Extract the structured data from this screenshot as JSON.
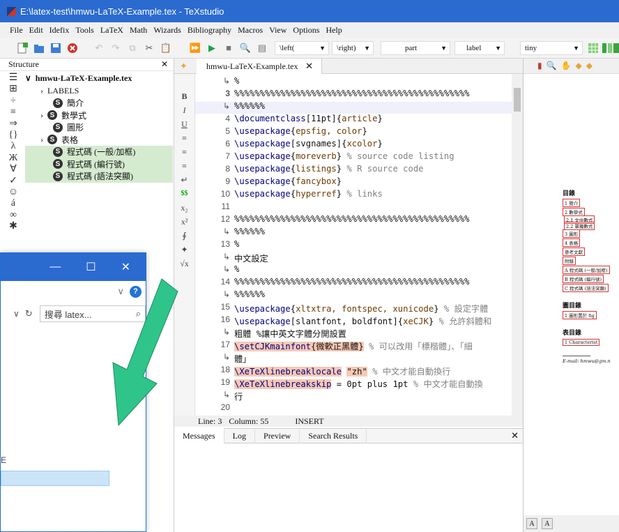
{
  "window": {
    "title": "E:\\latex-test\\hmwu-LaTeX-Example.tex - TeXstudio"
  },
  "menu": [
    "File",
    "Edit",
    "Idefix",
    "Tools",
    "LaTeX",
    "Math",
    "Wizards",
    "Bibliography",
    "Macros",
    "View",
    "Options",
    "Help"
  ],
  "toolbar": {
    "left_combo": "\\left(",
    "right_combo": "\\right)",
    "section_combo": "part",
    "ref_combo": "label",
    "size_combo": "tiny"
  },
  "structure": {
    "header": "Structure",
    "close": "✕",
    "sidebar_symbols": [
      "☰",
      "⊞",
      "÷",
      "≡",
      "⇒",
      "{}",
      "λ",
      "Ж",
      "∀",
      "✓",
      "☺",
      "á",
      "∞",
      "✱"
    ],
    "file": "hmwu-LaTeX-Example.tex",
    "labels": "LABELS",
    "sections": [
      "簡介",
      "數學式",
      "圖形",
      "表格",
      "程式碼 (一般/加框)",
      "程式碼 (編行號)",
      "程式碼 (語法突顯)"
    ],
    "section_icon_letter": "S"
  },
  "explorer": {
    "minimize": "—",
    "maximize": "☐",
    "close": "✕",
    "chevron": "∨",
    "help": "?",
    "refresh": "↻",
    "search_placeholder": "搜尋 latex...",
    "search_glyph": "⌕",
    "fragment": "E"
  },
  "editor": {
    "tab_name": "hmwu-LaTeX-Example.tex",
    "tab_close": "✕",
    "format_tools": [
      "B",
      "I",
      "U",
      "≡",
      "≡",
      "≡",
      "↵",
      "$$",
      "x₂",
      "x²",
      "∮",
      "✦",
      "√x"
    ],
    "status": {
      "line": "Line: 3",
      "column": "Column: 55",
      "mode": "INSERT"
    }
  },
  "bottom_tabs": [
    "Messages",
    "Log",
    "Preview",
    "Search Results"
  ],
  "pdf": {
    "toc_title": "目錄",
    "toc": [
      "1 簡介",
      "2 數學式",
      "2.1 文中數式",
      "2.2 單獨數式",
      "3 圖形",
      "4 表格",
      "參考文獻",
      "附錄",
      "A 程式碼 (一般/加框)",
      "B 程式碼 (編行號)",
      "C 程式碼 (語法突顯)"
    ],
    "lof_title": "圖目錄",
    "lof": [
      "1 圖形置於 fig"
    ],
    "lot_title": "表目錄",
    "lot": [
      "1 Characterist"
    ],
    "footnote": "E-mail: hmwu@gm.n"
  },
  "colors": {
    "titlebar": "#2b6bd0",
    "highlight_green": "#d5ebd0",
    "arrow": "#2fc48a",
    "selected_blue": "#cce4f7"
  }
}
